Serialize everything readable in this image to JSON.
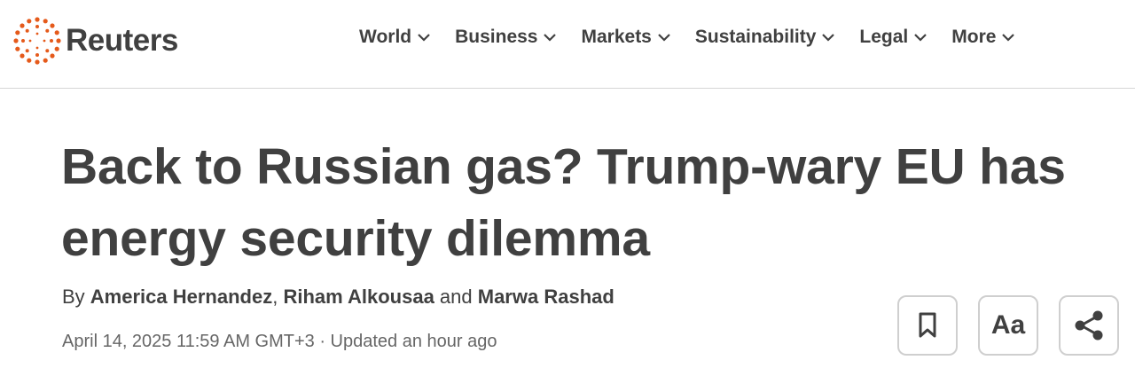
{
  "brand": {
    "name": "Reuters",
    "accent_color": "#e55a1b"
  },
  "nav": {
    "items": [
      {
        "label": "World"
      },
      {
        "label": "Business"
      },
      {
        "label": "Markets"
      },
      {
        "label": "Sustainability"
      },
      {
        "label": "Legal"
      },
      {
        "label": "More"
      }
    ]
  },
  "article": {
    "headline_line1": "Back to Russian gas? Trump-wary EU has",
    "headline_line2": "energy security dilemma",
    "byline": {
      "prefix": "By ",
      "author1": "America Hernandez",
      "sep1": ", ",
      "author2": "Riham Alkousaa",
      "sep2": " and ",
      "author3": "Marwa Rashad"
    },
    "dateline": "April 14, 2025 11:59 AM GMT+3 · Updated an hour ago"
  },
  "tools": {
    "bookmark_icon": "bookmark-icon",
    "text_size_label": "Aa",
    "share_icon": "share-icon"
  }
}
